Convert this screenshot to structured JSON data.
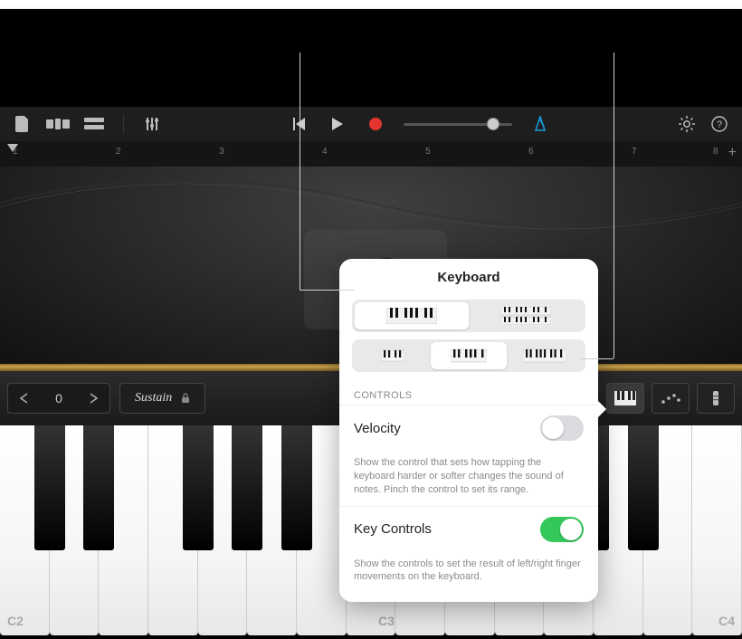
{
  "toolbar": {
    "volume_percent": 77
  },
  "ruler": {
    "bars": [
      "1",
      "2",
      "3",
      "4",
      "5",
      "6",
      "7",
      "8"
    ]
  },
  "controls_strip": {
    "octave": "0",
    "sustain_label": "Sustain"
  },
  "keyboard_labels": {
    "c2": "C2",
    "c3": "C3",
    "c4": "C4"
  },
  "popover": {
    "title": "Keyboard",
    "section_label": "CONTROLS",
    "velocity": {
      "label": "Velocity",
      "description": "Show the control that sets how tapping the keyboard harder or softer changes the sound of notes. Pinch the control to set its range.",
      "on": false
    },
    "key_controls": {
      "label": "Key Controls",
      "description": "Show the controls to set the result of left/right finger movements on the keyboard.",
      "on": true
    },
    "layout_selected": "single",
    "size_selected": "medium"
  }
}
